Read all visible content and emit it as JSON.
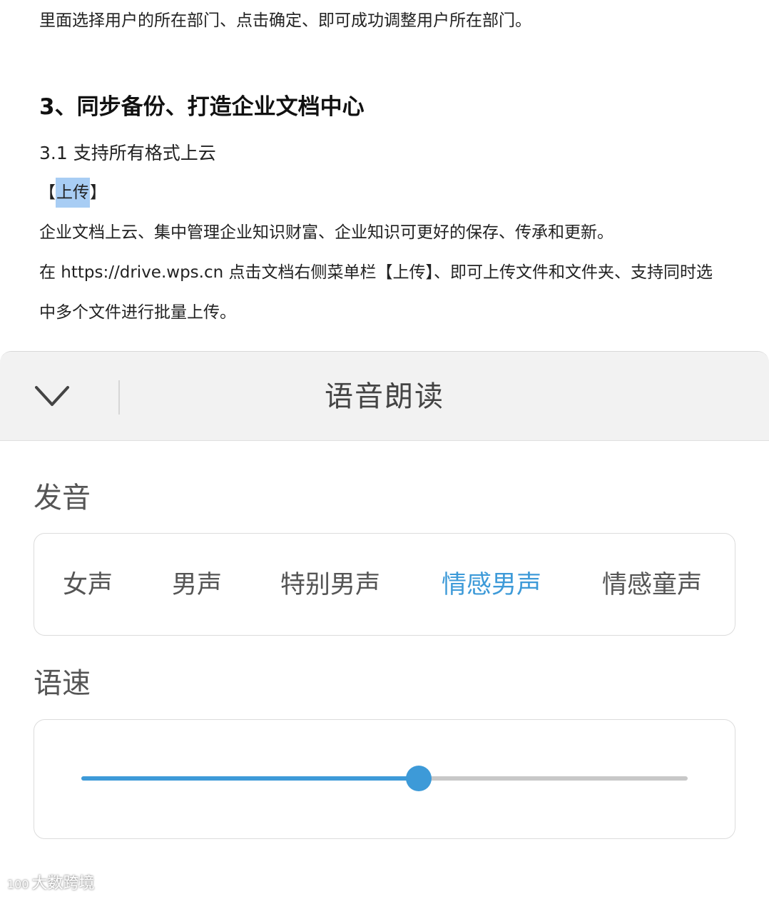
{
  "document": {
    "line1": "里面选择用户的所在部门、点击确定、即可成功调整用户所在部门。",
    "heading": "3、同步备份、打造企业文档中心",
    "subheading": "3.1 支持所有格式上云",
    "tag_open": "【",
    "tag_highlight": "上传",
    "tag_close": "】",
    "para1": "企业文档上云、集中管理企业知识财富、企业知识可更好的保存、传承和更新。",
    "para2": "在 https://drive.wps.cn 点击文档右侧菜单栏【上传】、即可上传文件和文件夹、支持同时选",
    "para3": "中多个文件进行批量上传。"
  },
  "sheet": {
    "collapse_icon": "chevron-down-icon",
    "title": "语音朗读",
    "voice_label": "发音",
    "voice_options": [
      "女声",
      "男声",
      "特别男声",
      "情感男声",
      "情感童声"
    ],
    "selected_voice": "情感男声",
    "speed_label": "语速",
    "speed_value": 0.556,
    "accent_color": "#3d9ad8"
  },
  "watermark": {
    "logo": "100",
    "text": "大数跨境"
  }
}
